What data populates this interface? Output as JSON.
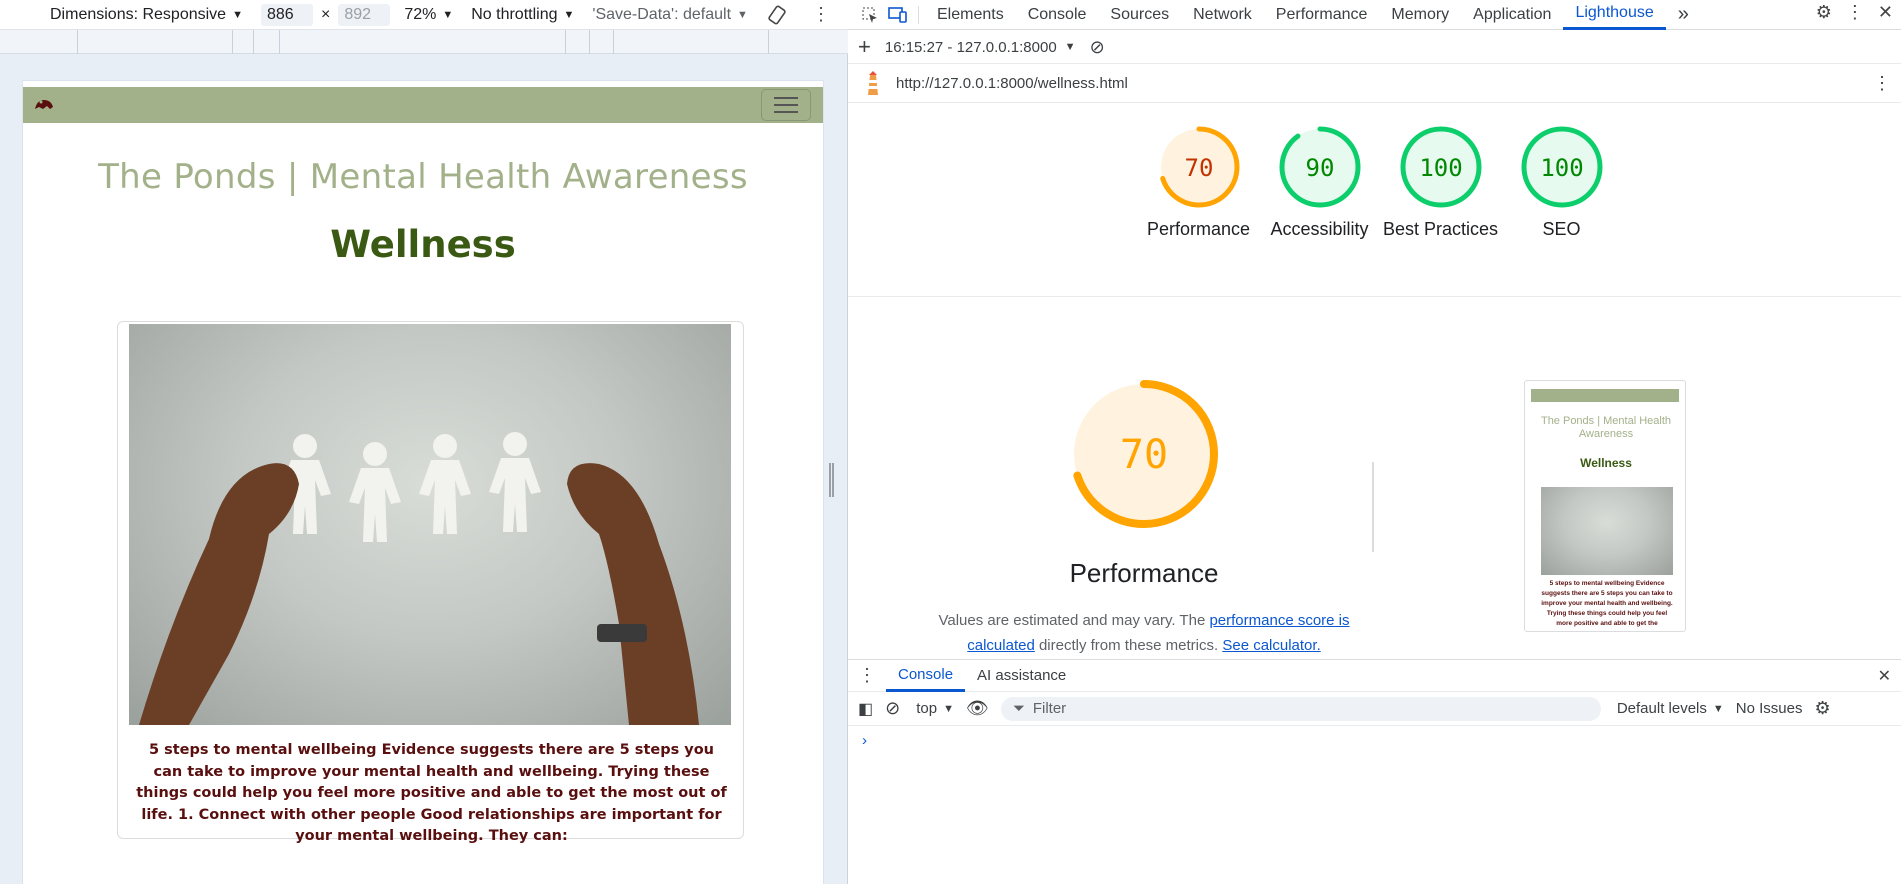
{
  "device_toolbar": {
    "dimensions_label": "Dimensions: Responsive",
    "width_value": "886",
    "times": "×",
    "height_value": "892",
    "zoom": "72%",
    "throttling": "No throttling",
    "save_data": "'Save-Data': default"
  },
  "site": {
    "title": "The Ponds | Mental Health Awareness",
    "heading": "Wellness",
    "card_text": "5 steps to mental wellbeing Evidence suggests there are 5 steps you can take to improve your mental health and wellbeing. Trying these things could help you feel more positive and able to get the most out of life. 1. Connect with other people Good relationships are important for your mental wellbeing. They can:"
  },
  "devtools": {
    "tabs": [
      "Elements",
      "Console",
      "Sources",
      "Network",
      "Performance",
      "Memory",
      "Application",
      "Lighthouse"
    ],
    "active_tab": "Lighthouse",
    "more": "»",
    "report_select": "16:15:27 - 127.0.0.1:8000",
    "url": "http://127.0.0.1:8000/wellness.html"
  },
  "lighthouse": {
    "scores": [
      {
        "label": "Performance",
        "value": "70",
        "color": "#ffa400",
        "text_color": "#c33300",
        "fill": "#fff3e0"
      },
      {
        "label": "Accessibility",
        "value": "90",
        "color": "#0cce6b",
        "text_color": "#008800",
        "fill": "#e6faf0"
      },
      {
        "label": "Best Practices",
        "value": "100",
        "color": "#0cce6b",
        "text_color": "#008800",
        "fill": "#e6faf0"
      },
      {
        "label": "SEO",
        "value": "100",
        "color": "#0cce6b",
        "text_color": "#008800",
        "fill": "#e6faf0"
      }
    ],
    "main_score": "70",
    "main_label": "Performance",
    "desc_prefix": "Values are estimated and may vary. The ",
    "desc_link1": "performance score is calculated",
    "desc_mid": " directly from these metrics. ",
    "desc_link2": "See calculator.",
    "thumb_title": "The Ponds | Mental Health Awareness",
    "thumb_heading": "Wellness",
    "thumb_text": "5 steps to mental wellbeing Evidence suggests there are 5 steps you can take to improve your mental health and wellbeing. Trying these things could help you feel more positive and able to get the"
  },
  "console": {
    "tab_console": "Console",
    "tab_ai": "AI assistance",
    "context": "top",
    "filter_placeholder": "Filter",
    "levels": "Default levels",
    "issues": "No Issues",
    "prompt": "›"
  }
}
